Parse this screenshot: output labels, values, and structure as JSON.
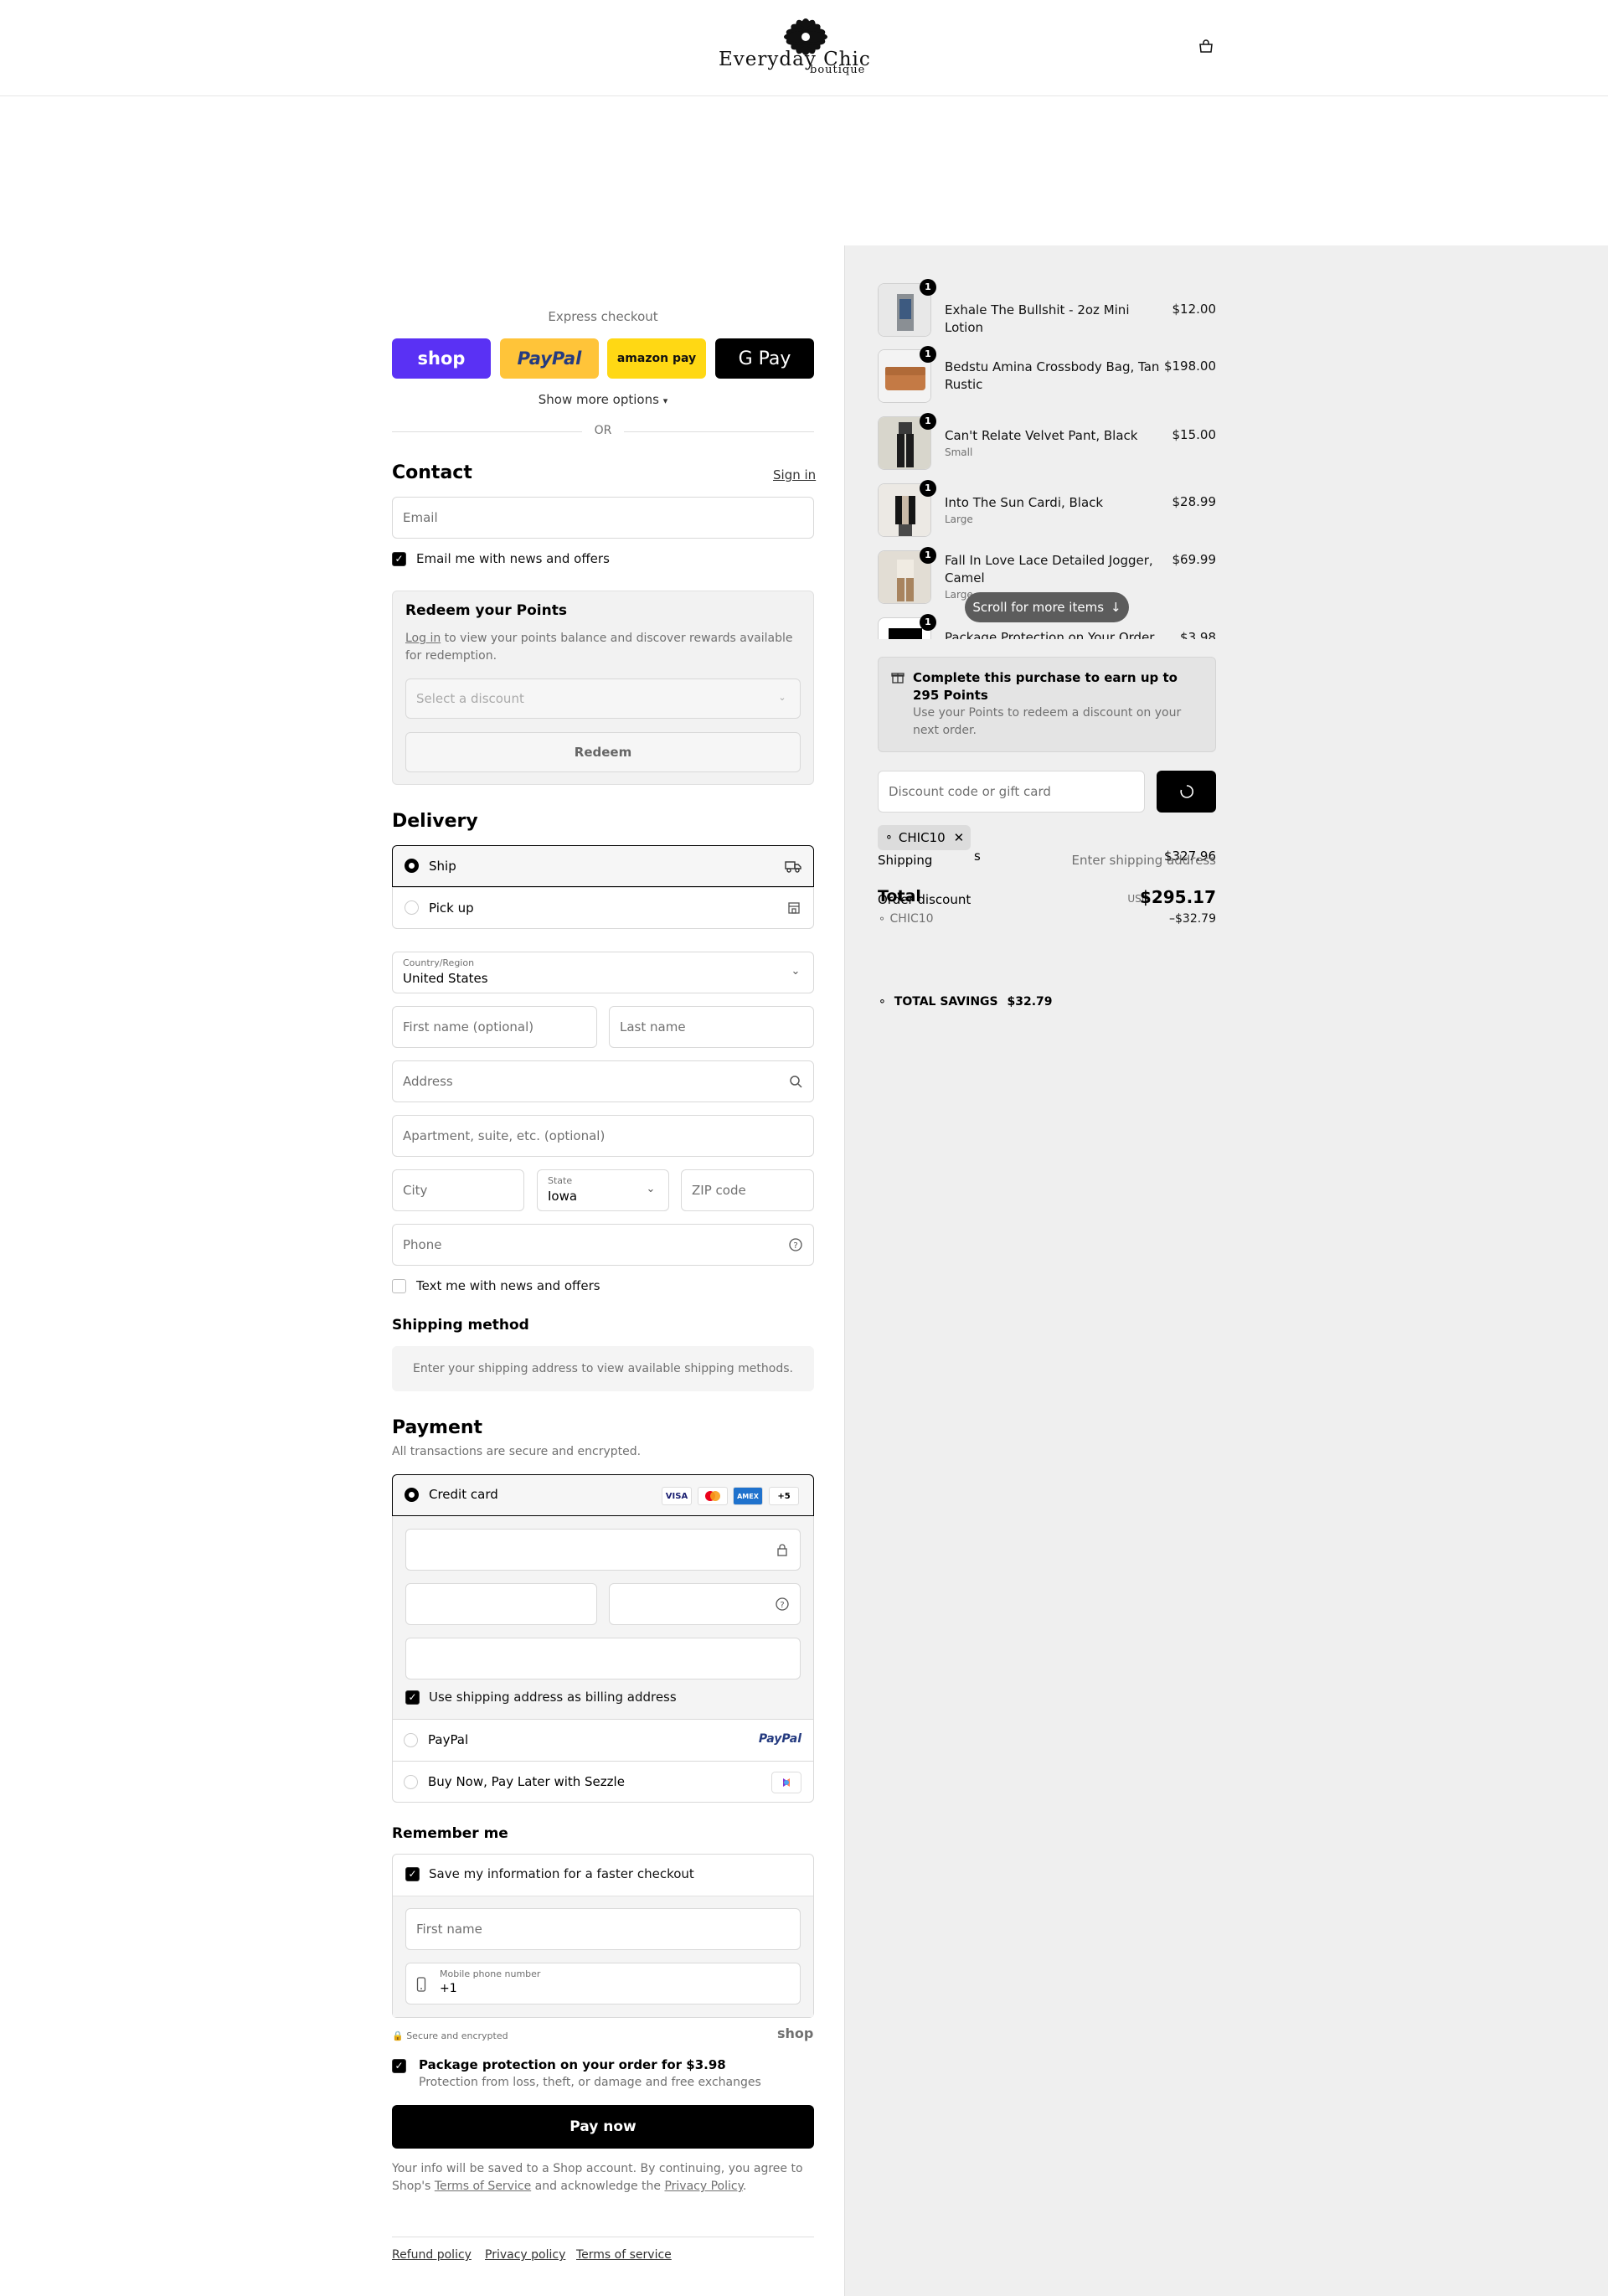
{
  "header": {
    "logo_main": "Everyday Chic",
    "logo_sub": "boutique"
  },
  "express": {
    "title": "Express checkout",
    "shop_label": "shop",
    "paypal_label": "PayPal",
    "amazon_label": "amazon pay",
    "gpay_label": "G Pay",
    "show_more": "Show more options",
    "or": "OR"
  },
  "contact": {
    "title": "Contact",
    "sign_in": "Sign in",
    "email_placeholder": "Email",
    "news_label": "Email me with news and offers"
  },
  "points": {
    "title": "Redeem your Points",
    "login_link": "Log in",
    "desc": " to view your points balance and discover rewards available for redemption.",
    "select_placeholder": "Select a discount",
    "redeem_label": "Redeem"
  },
  "delivery": {
    "title": "Delivery",
    "ship_label": "Ship",
    "pickup_label": "Pick up",
    "country_label": "Country/Region",
    "country_value": "United States",
    "first_name_placeholder": "First name (optional)",
    "last_name_placeholder": "Last name",
    "address_placeholder": "Address",
    "apartment_placeholder": "Apartment, suite, etc. (optional)",
    "city_placeholder": "City",
    "state_label": "State",
    "state_value": "Iowa",
    "zip_placeholder": "ZIP code",
    "phone_placeholder": "Phone",
    "text_label": "Text me with news and offers"
  },
  "shipping_method": {
    "title": "Shipping method",
    "message": "Enter your shipping address to view available shipping methods."
  },
  "payment": {
    "title": "Payment",
    "subtitle": "All transactions are secure and encrypted.",
    "credit_card_label": "Credit card",
    "badges": [
      "VISA",
      "MC",
      "AMEX",
      "+5"
    ],
    "billing_label": "Use shipping address as billing address",
    "paypal_label": "PayPal",
    "paypal_logo": "PayPal",
    "sezzle_label": "Buy Now, Pay Later with Sezzle"
  },
  "remember": {
    "title": "Remember me",
    "save_label": "Save my information for a faster checkout",
    "first_name_placeholder": "First name",
    "mobile_label": "Mobile phone number",
    "mobile_prefix": "+1",
    "secure_label": "Secure and encrypted",
    "shop_logo": "shop"
  },
  "protection": {
    "title": "Package protection on your order for $3.98",
    "desc": "Protection from loss, theft, or damage and free exchanges"
  },
  "pay_now": "Pay now",
  "legal": {
    "prefix": "Your info will be saved to a Shop account. By continuing, you agree to Shop's ",
    "tos": "Terms of Service",
    "mid": " and acknowledge the ",
    "privacy": "Privacy Policy",
    "suffix": "."
  },
  "footer_links": [
    "Refund policy",
    "Privacy policy",
    "Terms of service"
  ],
  "summary": {
    "items": [
      {
        "qty": "1",
        "name": "Exhale The Bullshit - 2oz Mini Lotion",
        "variant": "",
        "price": "$12.00"
      },
      {
        "qty": "1",
        "name": "Bedstu Amina Crossbody Bag, Tan Rustic",
        "variant": "",
        "price": "$198.00"
      },
      {
        "qty": "1",
        "name": "Can't Relate Velvet Pant, Black",
        "variant": "Small",
        "price": "$15.00"
      },
      {
        "qty": "1",
        "name": "Into The Sun Cardi, Black",
        "variant": "Large",
        "price": "$28.99"
      },
      {
        "qty": "1",
        "name": "Fall In Love Lace Detailed Jogger, Camel",
        "variant": "Large",
        "price": "$69.99"
      },
      {
        "qty": "1",
        "name": "Package Protection on Your Order",
        "variant": "",
        "price": "$3.98"
      }
    ],
    "scroll_label": "Scroll for more items",
    "earn_title": "Complete this purchase to earn up to 295 Points",
    "earn_desc": "Use your Points to redeem a discount on your next order.",
    "discount_placeholder": "Discount code or gift card",
    "chip_code": "CHIC10",
    "subtotal_label": "s",
    "subtotal_value": "$327.96",
    "shipping_label": "Shipping",
    "shipping_value": "Enter shipping address",
    "total_label": "Total",
    "order_discount_label": "Order discount",
    "currency": "USD",
    "total_value": "$295.17",
    "discount_code": "CHIC10",
    "discount_value": "–$32.79",
    "savings_label": "TOTAL SAVINGS",
    "savings_value": "$32.79"
  }
}
